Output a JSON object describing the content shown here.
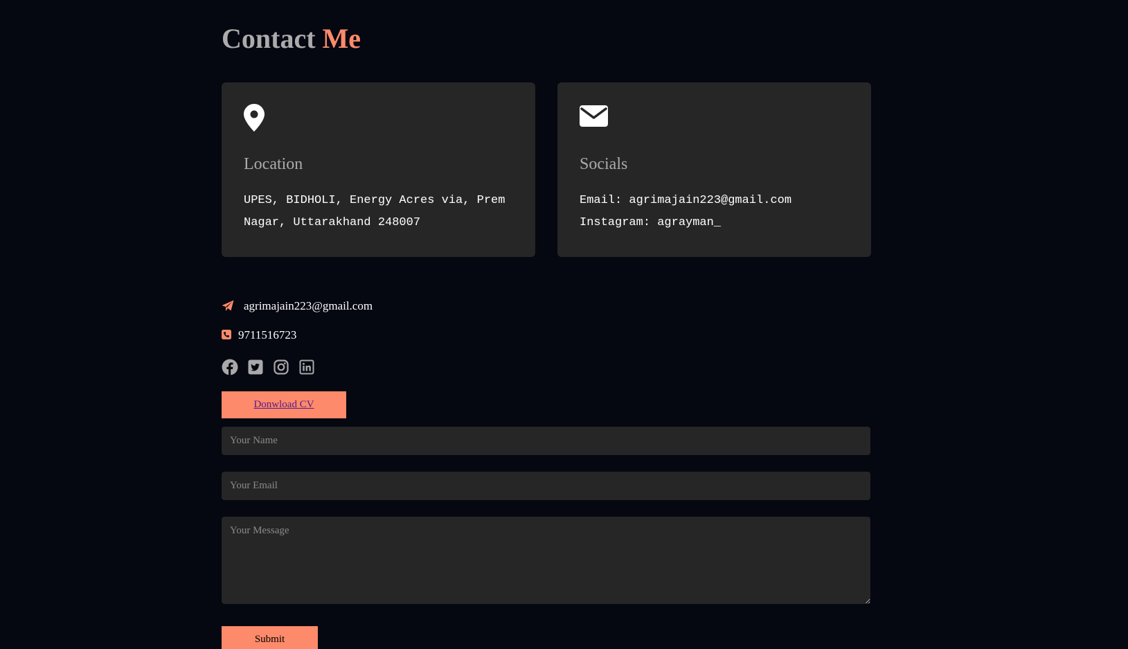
{
  "header": {
    "title_main": "Contact",
    "title_accent": "Me"
  },
  "colors": {
    "background": "#050711",
    "card": "#262626",
    "accent": "#fd8a6a",
    "muted_text": "#ababab"
  },
  "cards": {
    "location": {
      "icon": "map-pin-icon",
      "title": "Location",
      "lines": [
        "UPES, BIDHOLI, Energy Acres via, Prem",
        "Nagar, Uttarakhand 248007"
      ]
    },
    "socials": {
      "icon": "envelope-icon",
      "title": "Socials",
      "lines": [
        "Email: agrimajain223@gmail.com",
        "Instagram: agrayman_"
      ]
    }
  },
  "contact_info": {
    "email": "agrimajain223@gmail.com",
    "phone": "9711516723"
  },
  "social_icons": [
    "facebook-icon",
    "twitter-icon",
    "instagram-icon",
    "linkedin-icon"
  ],
  "cv_button": {
    "label": "Donwload CV"
  },
  "form": {
    "name_placeholder": "Your Name",
    "email_placeholder": "Your Email",
    "message_placeholder": "Your Message",
    "submit_label": "Submit"
  }
}
